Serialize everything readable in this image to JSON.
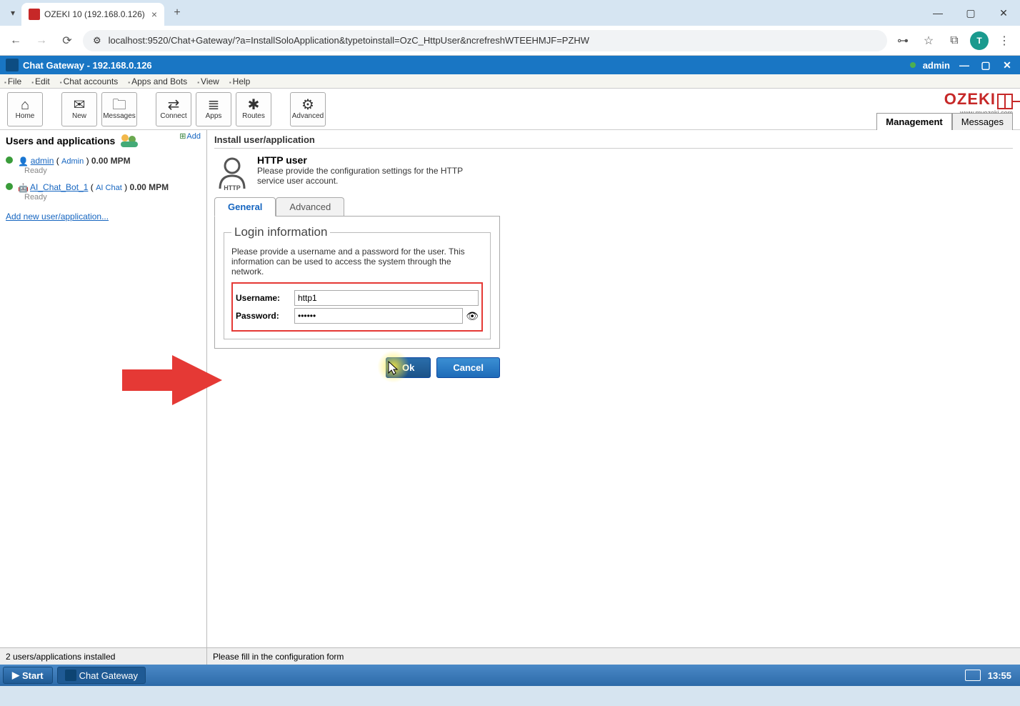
{
  "browser": {
    "tab_title": "OZEKI 10 (192.168.0.126)",
    "url": "localhost:9520/Chat+Gateway/?a=InstallSoloApplication&typetoinstall=OzC_HttpUser&ncrefreshWTEEHMJF=PZHW",
    "avatar_letter": "T"
  },
  "app_header": {
    "title": "Chat Gateway - 192.168.0.126",
    "user": "admin"
  },
  "menus": [
    "File",
    "Edit",
    "Chat accounts",
    "Apps and Bots",
    "View",
    "Help"
  ],
  "toolbar": {
    "home": "Home",
    "new": "New",
    "messages": "Messages",
    "connect": "Connect",
    "apps": "Apps",
    "routes": "Routes",
    "advanced": "Advanced"
  },
  "ozeki": {
    "brand": "OZEKI",
    "sub": "www.myozeki.com"
  },
  "right_tabs": {
    "management": "Management",
    "messages": "Messages"
  },
  "sidebar": {
    "title": "Users and applications",
    "add": "Add",
    "items": [
      {
        "name": "admin",
        "kind": "Admin",
        "mpm": "0.00 MPM",
        "status": "Ready"
      },
      {
        "name": "AI_Chat_Bot_1",
        "kind": "AI Chat",
        "mpm": "0.00 MPM",
        "status": "Ready"
      }
    ],
    "add_new": "Add new user/application..."
  },
  "content": {
    "heading": "Install user/application",
    "subject": "HTTP user",
    "desc": "Please provide the configuration settings for the HTTP service user account.",
    "tabs": {
      "general": "General",
      "advanced": "Advanced"
    },
    "fieldset_title": "Login information",
    "fieldset_desc": "Please provide a username and a password for the user. This information can be used to access the system through the network.",
    "username_label": "Username:",
    "username_value": "http1",
    "password_label": "Password:",
    "password_value": "••••••",
    "ok": "Ok",
    "cancel": "Cancel"
  },
  "statusbar": {
    "left": "2 users/applications installed",
    "right": "Please fill in the configuration form"
  },
  "taskbar": {
    "start": "Start",
    "app": "Chat Gateway",
    "clock": "13:55"
  }
}
